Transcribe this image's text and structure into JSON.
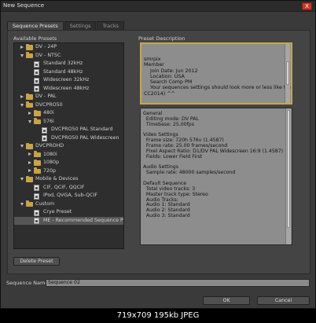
{
  "window": {
    "title": "New Sequence",
    "close_label": "X"
  },
  "tabs": [
    {
      "label": "Sequence Presets"
    },
    {
      "label": "Settings"
    },
    {
      "label": "Tracks"
    }
  ],
  "presets_panel": {
    "heading": "Available Presets"
  },
  "description_panel": {
    "heading": "Preset Description"
  },
  "tree": [
    {
      "label": "DV - 24P",
      "type": "folder",
      "expanded": false,
      "level": 1
    },
    {
      "label": "DV - NTSC",
      "type": "folder",
      "expanded": true,
      "level": 1
    },
    {
      "label": "Standard 32kHz",
      "type": "preset",
      "level": 2
    },
    {
      "label": "Standard 48kHz",
      "type": "preset",
      "level": 2
    },
    {
      "label": "Widescreen 32kHz",
      "type": "preset",
      "level": 2
    },
    {
      "label": "Widescreen 48kHz",
      "type": "preset",
      "level": 2
    },
    {
      "label": "DV - PAL",
      "type": "folder",
      "expanded": false,
      "level": 1
    },
    {
      "label": "DVCPRO50",
      "type": "folder",
      "expanded": true,
      "level": 1
    },
    {
      "label": "480i",
      "type": "folder",
      "expanded": false,
      "level": 2
    },
    {
      "label": "576i",
      "type": "folder",
      "expanded": true,
      "level": 2
    },
    {
      "label": "DVCPRO50 PAL Standard",
      "type": "preset",
      "level": 3
    },
    {
      "label": "DVCPRO50 PAL Widescreen",
      "type": "preset",
      "level": 3
    },
    {
      "label": "DVCPROHD",
      "type": "folder",
      "expanded": true,
      "level": 1
    },
    {
      "label": "1080i",
      "type": "folder",
      "expanded": false,
      "level": 2
    },
    {
      "label": "1080p",
      "type": "folder",
      "expanded": false,
      "level": 2
    },
    {
      "label": "720p",
      "type": "folder",
      "expanded": false,
      "level": 2
    },
    {
      "label": "Mobile & Devices",
      "type": "folder",
      "expanded": true,
      "level": 1
    },
    {
      "label": "CIF, QCIF, QQCIF",
      "type": "preset",
      "level": 2
    },
    {
      "label": "iPod, QVGA, Sub-QCIF",
      "type": "preset",
      "level": 2
    },
    {
      "label": "Custom",
      "type": "folder",
      "expanded": true,
      "level": 1
    },
    {
      "label": "Crye Preset",
      "type": "preset",
      "level": 2
    },
    {
      "label": "ME - Recommended Sequence Prese",
      "type": "preset",
      "level": 2,
      "selected": true
    }
  ],
  "comment_lines": [
    "smrpix",
    "Member",
    "    Join Date: Jun 2012",
    "    Location: USA",
    "    Search Comp PM",
    "",
    "    Your sequences settings should look more or less like this (I'm on",
    "CC2014) ^^"
  ],
  "settings_lines": [
    "General",
    "  Editing mode: DV PAL",
    "  Timebase: 25.00fps",
    "",
    "Video Settings",
    "  Frame size: 720h 576v (1.4587)",
    "  Frame rate: 25.00 frames/second",
    "  Pixel Aspect Ratio: D1/DV PAL Widescreen 16:9 (1.4587)",
    "  Fields: Lower Field First",
    "",
    "Audio Settings",
    "  Sample rate: 48000 samples/second",
    "",
    "Default Sequence",
    "  Total video tracks: 3",
    "  Master track type: Stereo",
    "  Audio Tracks:",
    "  Audio 1: Standard",
    "  Audio 2: Standard",
    "  Audio 3: Standard"
  ],
  "buttons": {
    "delete_preset": "Delete Preset",
    "ok": "OK",
    "cancel": "Cancel"
  },
  "sequence_name": {
    "label": "Sequence Name:",
    "value": "Sequence 02"
  },
  "footer": {
    "text": "719x709 195kb JPEG"
  },
  "colors": {
    "accent_border": "#c8a64b",
    "folder": "#c9a24a",
    "close": "#c53a2a"
  }
}
